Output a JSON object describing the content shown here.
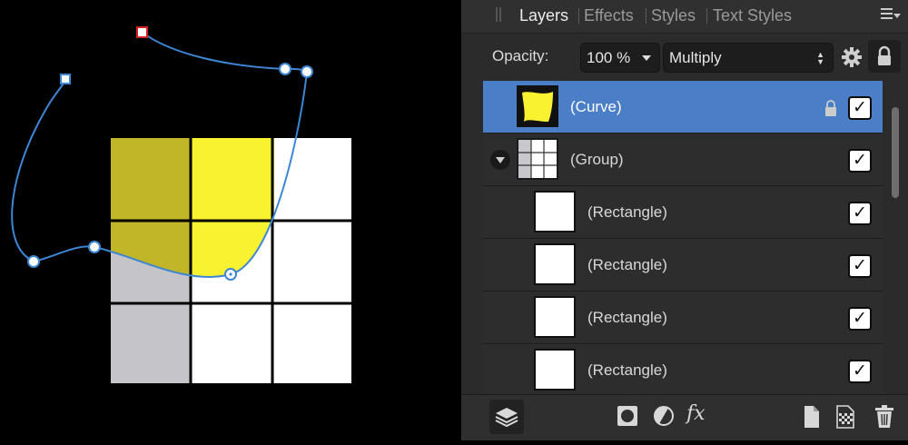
{
  "tabs": [
    {
      "label": "Layers",
      "active": true
    },
    {
      "label": "Effects",
      "active": false
    },
    {
      "label": "Styles",
      "active": false
    },
    {
      "label": "Text Styles",
      "active": false
    }
  ],
  "opacity": {
    "label": "Opacity:",
    "value": "100 %"
  },
  "blend_mode": "Multiply",
  "layers": [
    {
      "name": "(Curve)",
      "selected": true,
      "locked": true,
      "visible": true
    },
    {
      "name": "(Group)",
      "expanded": true,
      "visible": true
    },
    {
      "name": "(Rectangle)",
      "visible": true
    },
    {
      "name": "(Rectangle)",
      "visible": true
    },
    {
      "name": "(Rectangle)",
      "visible": true
    },
    {
      "name": "(Rectangle)",
      "visible": true
    }
  ],
  "check_glyph": "✓",
  "fx_label": "fx",
  "colors": {
    "selection_blue": "#4a7fc8",
    "curve_fill": "#f8f231",
    "curve_fill_dark": "#c1b528",
    "stroke_blue": "#3d86d4",
    "gray_cell": "#c5c4c9"
  },
  "icons": [
    "layers-stack-icon",
    "mask-icon",
    "adjustment-icon",
    "fx-icon",
    "new-layer-icon",
    "new-pixel-layer-icon",
    "trash-icon",
    "gear-icon",
    "lock-icon"
  ]
}
